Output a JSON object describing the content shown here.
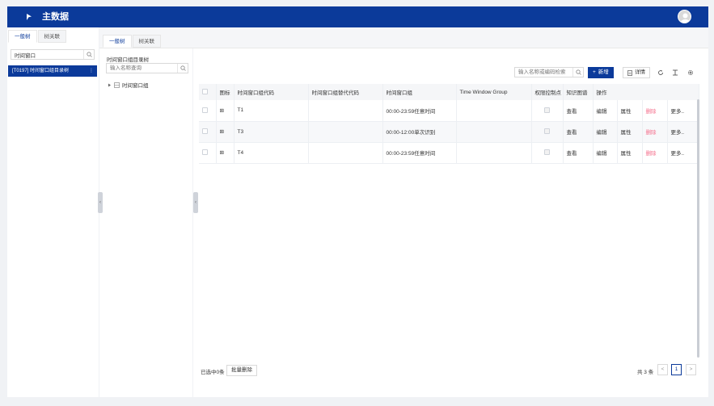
{
  "app": {
    "title": "主数据"
  },
  "left_panel": {
    "tabs": [
      "一般树",
      "树关联"
    ],
    "search": {
      "value": "时间窗口",
      "placeholder": ""
    },
    "selected_item": "[T0197] 时间窗口组目录树",
    "item_menu": "⋮"
  },
  "mid_panel": {
    "tabs": [
      "一般树",
      "树关联"
    ],
    "label": "时间窗口组目录树",
    "search": {
      "value": "",
      "placeholder": "输入名称查询"
    },
    "tree_node": "时间窗口组"
  },
  "toolbar": {
    "search_placeholder": "输入名称或编码检索",
    "new_label": "新增",
    "detail_label": "详情"
  },
  "table": {
    "columns": [
      "",
      "图标",
      "时间窗口组代码",
      "时间窗口组替代代码",
      "时间窗口组",
      "Time Window Group",
      "权限控制点",
      "知识图谱",
      "操作"
    ],
    "rows": [
      {
        "icon": "⊞",
        "code": "T1",
        "alt_code": "",
        "name": "00:00-23:59任意时间",
        "tw_group": ""
      },
      {
        "icon": "⊞",
        "code": "T3",
        "alt_code": "",
        "name": "00:00-12:00单次识别",
        "tw_group": ""
      },
      {
        "icon": "⊞",
        "code": "T4",
        "alt_code": "",
        "name": "00:00-23:59任意时间",
        "tw_group": ""
      }
    ],
    "row_actions": {
      "view": "查看",
      "edit": "编辑",
      "props": "属性",
      "delete": "删除",
      "more": "更多.."
    }
  },
  "footer": {
    "selected_text": "已选中0条",
    "batch_delete": "批量删除",
    "total": "共 3 条",
    "prev": "<",
    "page": "1",
    "next": ">"
  },
  "colors": {
    "brand": "#0b3a9a",
    "danger": "#f56c8a",
    "link": "#1f4fb5"
  }
}
